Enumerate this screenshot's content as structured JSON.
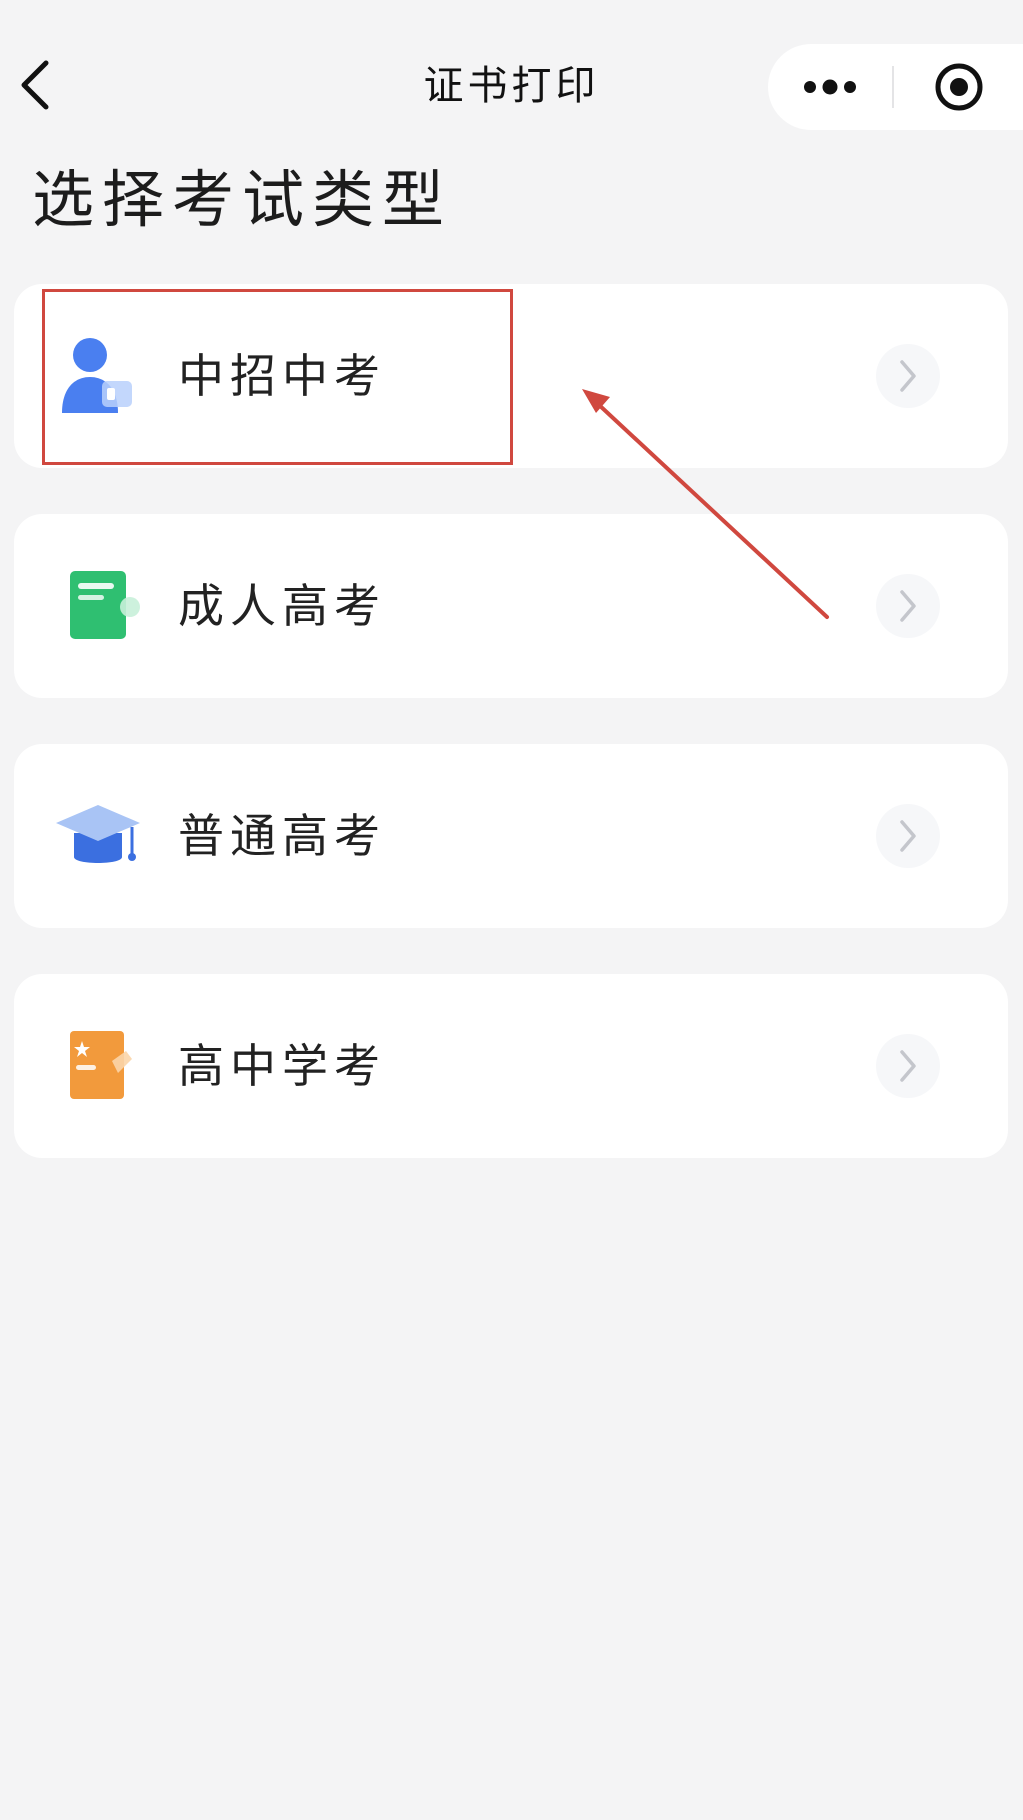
{
  "nav": {
    "title": "证书打印",
    "back_icon": "chevron-left-icon",
    "more_icon": "more-dots-icon",
    "close_icon": "target-close-icon"
  },
  "heading": "选择考试类型",
  "exam_types": [
    {
      "label": "中招中考",
      "icon": "student-icon",
      "color": "#4a7ff0"
    },
    {
      "label": "成人高考",
      "icon": "book-icon",
      "color": "#2fbf71"
    },
    {
      "label": "普通高考",
      "icon": "graduation-cap-icon",
      "color": "#3b6fe0"
    },
    {
      "label": "高中学考",
      "icon": "certificate-icon",
      "color": "#f29a3c"
    }
  ],
  "annotation": {
    "color": "#d0483f"
  }
}
